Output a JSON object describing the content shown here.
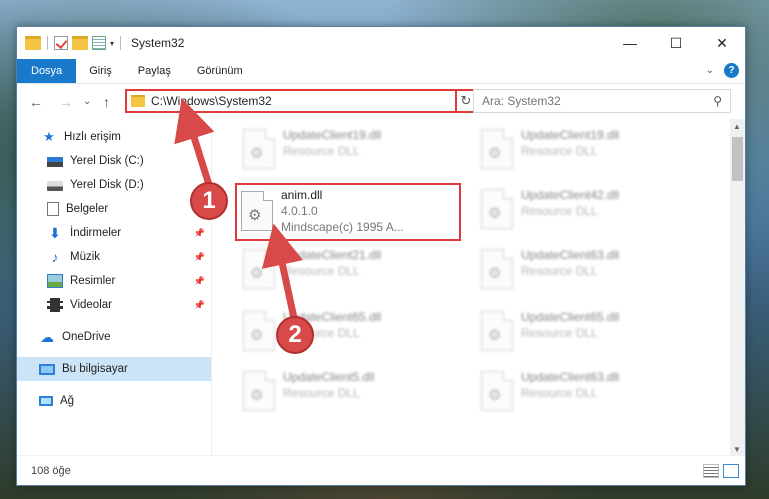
{
  "window": {
    "title": "System32",
    "controls": {
      "minimize": "—",
      "maximize": "☐",
      "close": "✕"
    }
  },
  "ribbon": {
    "tabs": [
      {
        "label": "Dosya",
        "active": true
      },
      {
        "label": "Giriş"
      },
      {
        "label": "Paylaş"
      },
      {
        "label": "Görünüm"
      }
    ],
    "help_label": "?"
  },
  "navbar": {
    "back": "←",
    "forward": "→",
    "recent": "⌄",
    "up": "↑",
    "address": "C:\\Windows\\System32",
    "refresh": "↻",
    "search_placeholder": "Ara: System32"
  },
  "sidebar": {
    "items": [
      {
        "label": "Hızlı erişim",
        "icon": "star-icon"
      },
      {
        "label": "Yerel Disk (C:)",
        "icon": "drive-c-icon"
      },
      {
        "label": "Yerel Disk (D:)",
        "icon": "drive-d-icon"
      },
      {
        "label": "Belgeler",
        "icon": "documents-icon",
        "pinned": true
      },
      {
        "label": "İndirmeler",
        "icon": "downloads-icon",
        "pinned": true
      },
      {
        "label": "Müzik",
        "icon": "music-icon",
        "pinned": true
      },
      {
        "label": "Resimler",
        "icon": "pictures-icon",
        "pinned": true
      },
      {
        "label": "Videolar",
        "icon": "videos-icon",
        "pinned": true
      },
      {
        "label": "OneDrive",
        "icon": "onedrive-icon"
      },
      {
        "label": "Bu bilgisayar",
        "icon": "this-pc-icon",
        "selected": true
      },
      {
        "label": "Ağ",
        "icon": "network-icon"
      }
    ]
  },
  "files": {
    "left": [
      {
        "name": "UpdateClient19.dll",
        "type": "Resource DLL"
      },
      {
        "name": "anim.dll",
        "version": "4.0.1.0",
        "company": "Mindscape(c) 1995 A...",
        "highlighted": true
      },
      {
        "name": "UpdateClient21.dll",
        "type": "Resource DLL"
      },
      {
        "name": "UpdateClient65.dll",
        "type": "Resource DLL"
      },
      {
        "name": "UpdateClient5.dll",
        "type": "Resource DLL"
      }
    ],
    "right": [
      {
        "name": "UpdateClient19.dll",
        "type": "Resource DLL"
      },
      {
        "name": "UpdateClient42.dll",
        "type": "Resource DLL"
      },
      {
        "name": "UpdateClient63.dll",
        "type": "Resource DLL"
      },
      {
        "name": "UpdateClient65.dll",
        "type": "Resource DLL"
      },
      {
        "name": "UpdateClient63.dll",
        "type": "Resource DLL"
      }
    ]
  },
  "status": {
    "count": "108 öğe"
  },
  "callouts": {
    "one": "1",
    "two": "2"
  },
  "colors": {
    "accent": "#1979ca",
    "highlight": "#e03a3a",
    "selected": "#cce4f7"
  }
}
